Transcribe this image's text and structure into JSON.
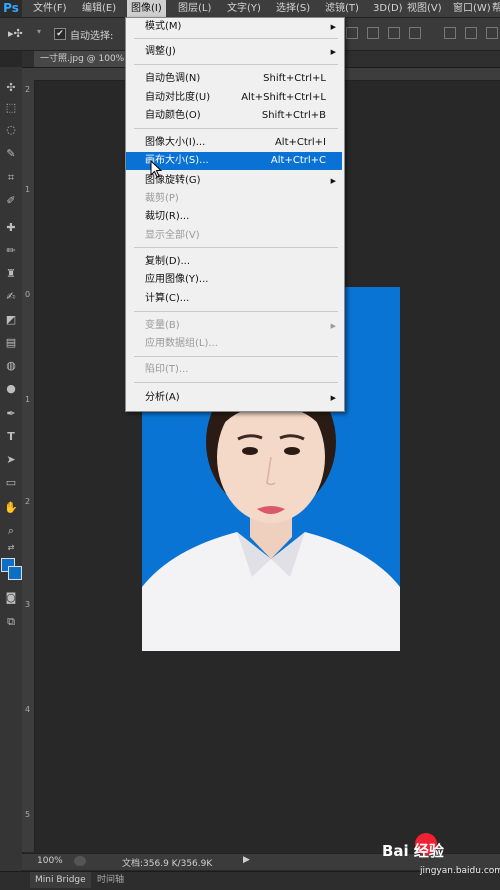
{
  "app": {
    "logo": "Ps"
  },
  "menubar": {
    "items": [
      "文件(F)",
      "编辑(E)",
      "图像(I)",
      "图层(L)",
      "文字(Y)",
      "选择(S)",
      "滤镜(T)",
      "3D(D)",
      "视图(V)",
      "窗口(W)",
      "帮"
    ]
  },
  "options_bar": {
    "auto_select_label": "自动选择:",
    "checkbox_mark": "✔"
  },
  "document": {
    "tab_title": "一寸照.jpg @ 100% (R",
    "zoom": "100%",
    "doc_info": "文档:356.9 K/356.9K"
  },
  "bottom_panel": {
    "tabs": [
      "Mini Bridge",
      "时间轴"
    ]
  },
  "ruler": {
    "left_marks": [
      "2",
      "1",
      "0",
      "1",
      "2",
      "3",
      "4",
      "5"
    ]
  },
  "image_menu": {
    "items": [
      {
        "label": "模式(M)",
        "shortcut": "",
        "submenu": true,
        "disabled": false
      },
      {
        "label": "调整(J)",
        "shortcut": "",
        "submenu": true,
        "disabled": false
      },
      {
        "label": "自动色调(N)",
        "shortcut": "Shift+Ctrl+L",
        "submenu": false,
        "disabled": false
      },
      {
        "label": "自动对比度(U)",
        "shortcut": "Alt+Shift+Ctrl+L",
        "submenu": false,
        "disabled": false
      },
      {
        "label": "自动颜色(O)",
        "shortcut": "Shift+Ctrl+B",
        "submenu": false,
        "disabled": false
      },
      {
        "label": "图像大小(I)...",
        "shortcut": "Alt+Ctrl+I",
        "submenu": false,
        "disabled": false
      },
      {
        "label": "画布大小(S)...",
        "shortcut": "Alt+Ctrl+C",
        "submenu": false,
        "disabled": false,
        "highlighted": true
      },
      {
        "label": "图像旋转(G)",
        "shortcut": "",
        "submenu": true,
        "disabled": false
      },
      {
        "label": "裁剪(P)",
        "shortcut": "",
        "submenu": false,
        "disabled": true
      },
      {
        "label": "裁切(R)...",
        "shortcut": "",
        "submenu": false,
        "disabled": false
      },
      {
        "label": "显示全部(V)",
        "shortcut": "",
        "submenu": false,
        "disabled": true
      },
      {
        "label": "复制(D)...",
        "shortcut": "",
        "submenu": false,
        "disabled": false
      },
      {
        "label": "应用图像(Y)...",
        "shortcut": "",
        "submenu": false,
        "disabled": false
      },
      {
        "label": "计算(C)...",
        "shortcut": "",
        "submenu": false,
        "disabled": false
      },
      {
        "label": "变量(B)",
        "shortcut": "",
        "submenu": true,
        "disabled": true
      },
      {
        "label": "应用数据组(L)...",
        "shortcut": "",
        "submenu": false,
        "disabled": true
      },
      {
        "label": "陷印(T)...",
        "shortcut": "",
        "submenu": false,
        "disabled": true
      },
      {
        "label": "分析(A)",
        "shortcut": "",
        "submenu": true,
        "disabled": false
      }
    ]
  },
  "watermark": {
    "logo_text": "Bai 经验",
    "url": "jingyan.baidu.com"
  },
  "colors": {
    "accent": "#0a72d4",
    "photo_bg": "#0a74d4",
    "canvas": "#282828"
  }
}
